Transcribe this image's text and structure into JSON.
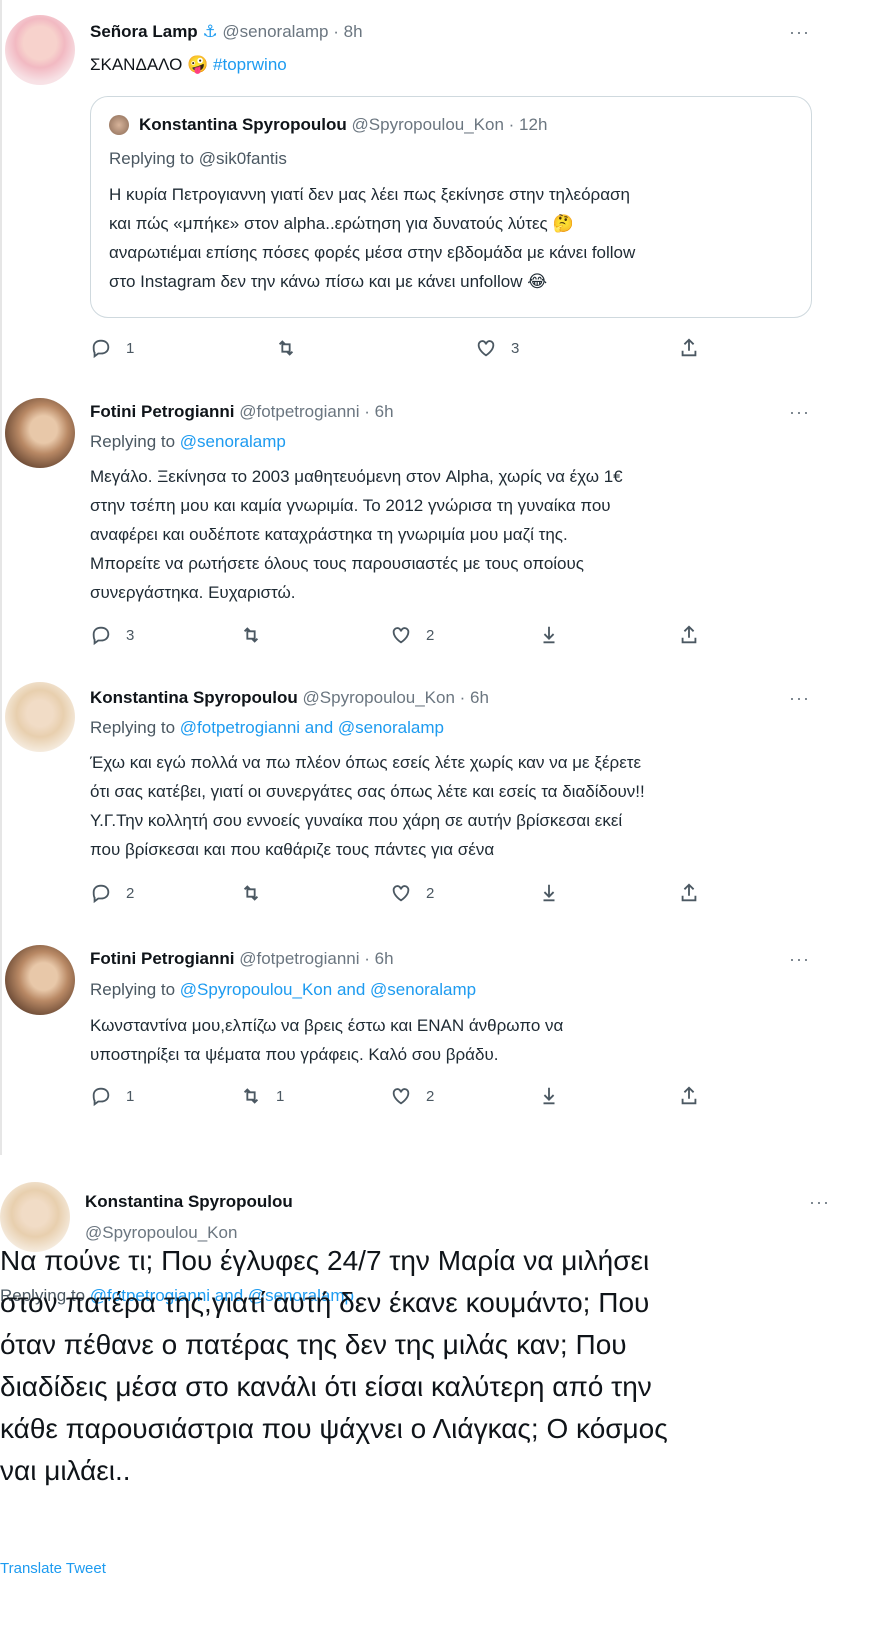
{
  "tweets": [
    {
      "name": "Señora Lamp",
      "anchor": "⚓",
      "handle": "@senoralamp · 8h",
      "text": "ΣΚΑΝΔΑΛΟ",
      "emoji": "🤪",
      "hashtag": "#toprwino",
      "quote": {
        "name": "Konstantina Spyropoulou",
        "handle": "@Spyropoulou_Kon · 12h",
        "reply_prefix": "Replying to @sik0fantis",
        "lines": [
          "Η κυρία Πετρογιαννη γιατί δεν μας λέει πως ξεκίνησε στην τηλεόραση",
          "και πώς «μπήκε» στον alpha..ερώτηση για δυνατούς λύτες 🤔",
          "αναρωτιέμαι επίσης πόσες φορές μέσα στην εβδομάδα με κάνει follow",
          "στο Instagram δεν την κάνω πίσω και με κάνει unfollow 😂"
        ]
      },
      "reply_count": "1",
      "retweet_count": "",
      "like_count": "3"
    },
    {
      "name": "Fotini Petrogianni",
      "handle": "@fotpetrogianni · 6h",
      "reply_prefix": "Replying to",
      "reply_to": "@senoralamp",
      "lines": [
        "Μεγάλο. Ξεκίνησα το 2003 μαθητευόμενη στον Alpha, χωρίς να έχω 1€",
        "στην τσέπη μου και καμία γνωριμία. Το 2012 γνώρισα τη γυναίκα που",
        "αναφέρει και ουδέποτε καταχράστηκα τη γνωριμία μου μαζί της.",
        "Μπορείτε να ρωτήσετε όλους τους παρουσιαστές με τους οποίους",
        "συνεργάστηκα. Ευχαριστώ."
      ],
      "reply_count": "3",
      "retweet_count": "",
      "like_count": "2"
    },
    {
      "name": "Konstantina Spyropoulou",
      "handle": "@Spyropoulou_Kon · 6h",
      "reply_prefix": "Replying to",
      "reply_to": "@fotpetrogianni and @senoralamp",
      "lines": [
        "Έχω και εγώ πολλά να πω πλέον όπως εσείς λέτε χωρίς καν να με ξέρετε",
        "ότι σας κατέβει, γιατί οι συνεργάτες σας όπως λέτε και εσείς τα διαδίδουν!!",
        "Υ.Γ.Την κολλητή σου εννοείς γυναίκα που χάρη σε αυτήν βρίσκεσαι εκεί",
        "που βρίσκεσαι και που καθάριζε τους πάντες για σένα"
      ],
      "reply_count": "2",
      "retweet_count": "",
      "like_count": "2"
    },
    {
      "name": "Fotini Petrogianni",
      "handle": "@fotpetrogianni · 6h",
      "reply_prefix": "Replying to",
      "reply_to": "@Spyropoulou_Kon and @senoralamp",
      "lines": [
        "Κωνσταντίνα μου,ελπίζω να βρεις έστω και ΕΝΑΝ άνθρωπο να",
        "υποστηρίξει τα ψέματα που γράφεις. Καλό σου βράδυ."
      ],
      "reply_count": "1",
      "retweet_count": "1",
      "like_count": "2"
    }
  ],
  "main": {
    "name": "Konstantina Spyropoulou",
    "handle": "@Spyropoulou_Kon",
    "reply_prefix": "Replying to",
    "reply_to": "@fotpetrogianni and @senoralamp",
    "lines": [
      "Να πούνε τι; Που έγλυφες 24/7 την Μαρία να μιλήσει",
      "στον πατέρα της,γιατί αυτή δεν έκανε κουμάντο; Που",
      "όταν πέθανε ο πατέρας της δεν της μιλάς καν; Που",
      "διαδίδεις μέσα στο κανάλι ότι είσαι καλύτερη από την",
      "κάθε παρουσιάστρια που ψάχνει ο Λιάγκας; Ο κόσμος",
      "ναι μιλάει.."
    ],
    "translate": "Translate Tweet"
  },
  "more_label": "···",
  "colors": {
    "link": "#1d9bf0",
    "text": "#0f1419",
    "muted": "#6b7680"
  },
  "icons": [
    "reply-icon",
    "retweet-icon",
    "like-icon",
    "download-icon",
    "share-icon"
  ]
}
